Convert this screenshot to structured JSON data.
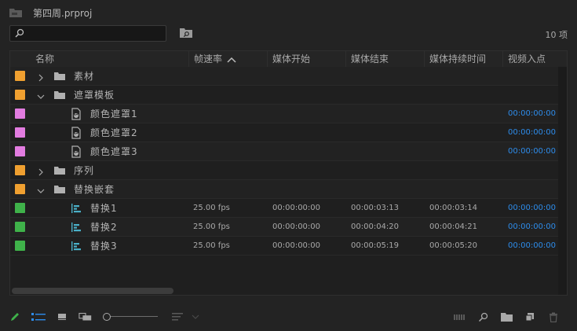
{
  "project": {
    "title": "第四周.prproj"
  },
  "search": {
    "value": "",
    "placeholder": ""
  },
  "item_count": "10 项",
  "columns": [
    "名称",
    "帧速率",
    "媒体开始",
    "媒体结束",
    "媒体持续时间",
    "视频入点"
  ],
  "sort": {
    "column": "帧速率",
    "direction": "ascending"
  },
  "colors": {
    "bin_label": "#f0a030",
    "matte_label": "#e27ce0",
    "sequence_label": "#3fb24a",
    "timecode_accent": "#2d8ceb"
  },
  "rows": [
    {
      "name": "素材",
      "type": "bin",
      "label": "orange",
      "expanded": false,
      "depth": 0,
      "fps": "",
      "media_start": "",
      "media_end": "",
      "duration": "",
      "video_in": ""
    },
    {
      "name": "遮罩模板",
      "type": "bin",
      "label": "orange",
      "expanded": true,
      "depth": 0,
      "fps": "",
      "media_start": "",
      "media_end": "",
      "duration": "",
      "video_in": ""
    },
    {
      "name": "颜色遮罩1",
      "type": "color-matte",
      "label": "pink",
      "depth": 1,
      "fps": "",
      "media_start": "",
      "media_end": "",
      "duration": "",
      "video_in": "00:00:00:00"
    },
    {
      "name": "颜色遮罩2",
      "type": "color-matte",
      "label": "pink",
      "depth": 1,
      "fps": "",
      "media_start": "",
      "media_end": "",
      "duration": "",
      "video_in": "00:00:00:00"
    },
    {
      "name": "颜色遮罩3",
      "type": "color-matte",
      "label": "pink",
      "depth": 1,
      "fps": "",
      "media_start": "",
      "media_end": "",
      "duration": "",
      "video_in": "00:00:00:00"
    },
    {
      "name": "序列",
      "type": "bin",
      "label": "orange",
      "expanded": false,
      "depth": 0,
      "fps": "",
      "media_start": "",
      "media_end": "",
      "duration": "",
      "video_in": ""
    },
    {
      "name": "替换嵌套",
      "type": "bin",
      "label": "orange",
      "expanded": true,
      "depth": 0,
      "fps": "",
      "media_start": "",
      "media_end": "",
      "duration": "",
      "video_in": ""
    },
    {
      "name": "替换1",
      "type": "sequence",
      "label": "green",
      "depth": 1,
      "fps": "25.00 fps",
      "media_start": "00:00:00:00",
      "media_end": "00:00:03:13",
      "duration": "00:00:03:14",
      "video_in": "00:00:00:00"
    },
    {
      "name": "替换2",
      "type": "sequence",
      "label": "green",
      "depth": 1,
      "fps": "25.00 fps",
      "media_start": "00:00:00:00",
      "media_end": "00:00:04:20",
      "duration": "00:00:04:21",
      "video_in": "00:00:00:00"
    },
    {
      "name": "替换3",
      "type": "sequence",
      "label": "green",
      "depth": 1,
      "fps": "25.00 fps",
      "media_start": "00:00:00:00",
      "media_end": "00:00:05:19",
      "duration": "00:00:05:20",
      "video_in": "00:00:00:00"
    }
  ],
  "bottom_toolbar": {
    "left_icons": [
      "pencil-icon",
      "list-view-icon",
      "icon-view-icon",
      "freeform-view-icon",
      "zoom-slider",
      "sort-icons-icon"
    ],
    "right_icons": [
      "automate-to-sequence-icon",
      "find-icon",
      "new-bin-icon",
      "new-item-icon",
      "clear-icon"
    ]
  }
}
